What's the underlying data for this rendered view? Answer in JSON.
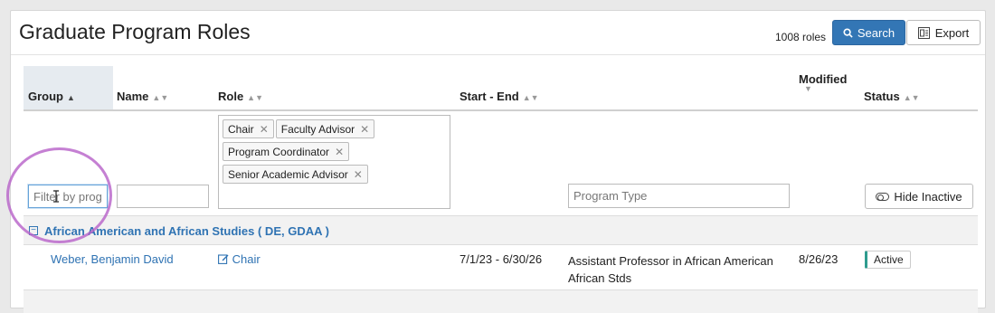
{
  "header": {
    "title": "Graduate Program Roles",
    "count": "1008 roles",
    "search_label": "Search",
    "export_label": "Export"
  },
  "columns": {
    "group": "Group",
    "name": "Name",
    "role": "Role",
    "start_end": "Start - End",
    "modified": "Modified",
    "status": "Status"
  },
  "filters": {
    "group_placeholder": "Filter by prog",
    "name_value": "",
    "role_chips": [
      "Chair",
      "Faculty Advisor",
      "Program Coordinator",
      "Senior Academic Advisor"
    ],
    "program_type_placeholder": "Program Type",
    "hide_inactive_label": "Hide Inactive"
  },
  "groups": [
    {
      "title": "African American and African Studies ( DE, GDAA )",
      "expander": "−",
      "rows": [
        {
          "name": "Weber, Benjamin David",
          "role": "Chair",
          "start_end": "7/1/23 - 6/30/26",
          "program_type_line1": "Assistant Professor in African American",
          "program_type_line2": "African Stds",
          "modified": "8/26/23",
          "status": "Active"
        }
      ]
    }
  ],
  "colors": {
    "primary": "#3376b5",
    "link": "#2f73b3",
    "active_status": "#2e9c8f",
    "annotation_ring": "#b760c8"
  }
}
